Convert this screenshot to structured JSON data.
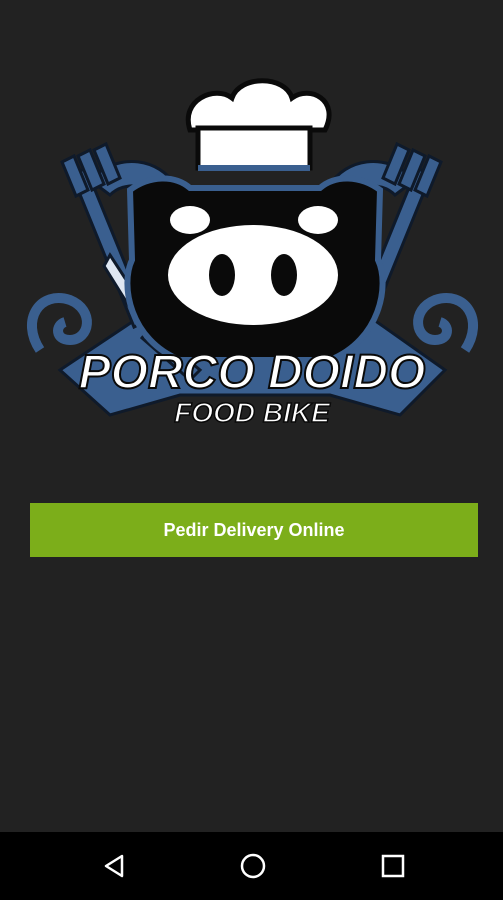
{
  "logo": {
    "brand_line1": "PORCO DOIDO",
    "brand_line2": "FOOD BIKE"
  },
  "cta": {
    "label": "Pedir Delivery Online"
  },
  "nav": {
    "back_icon": "back-icon",
    "home_icon": "home-icon",
    "recents_icon": "recents-icon"
  },
  "colors": {
    "background": "#222222",
    "button": "#7cae1a",
    "logo_blue": "#3a5f8f",
    "navbar": "#000000"
  }
}
